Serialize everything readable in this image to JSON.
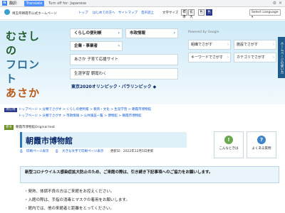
{
  "translate_bar": {
    "logo": "G",
    "label": "翻訳:",
    "translate_button": "Translate",
    "options_link": "Turn off for: Japanese"
  },
  "header": {
    "site_name": "埼玉県朝霞市公式ホームページ",
    "links": [
      "トップ",
      "はじめての方へ",
      "サイトマップ",
      "音声読上"
    ],
    "font_size_label": "文字サイズ",
    "font_buttons": [
      "標準",
      "拡大",
      "色",
      "色"
    ],
    "language_select": "Select Language"
  },
  "hero": {
    "logo_lines": [
      "むさしの",
      "フロント",
      "あさか"
    ],
    "menu": {
      "living": "くらしの便利帳",
      "city": "市政情報",
      "business": "企業・事業者",
      "kids": "あさか 子育て応援サイト",
      "shogai": "生涯学習 朝霞わく"
    },
    "olympics_link": "東京2020オリンピック・パラリンピック ◆",
    "search": {
      "header": "Powered by Google",
      "by_life": "組織でさがす",
      "by_shisetsu": "施設でさがす",
      "by_keyword": "キーワードでさがす",
      "by_other": "カテゴリでさがす"
    },
    "side_tab": "ホームページの使い方"
  },
  "breadcrumbs": {
    "label": "現在地",
    "line1": "トップページ > 分類でさがす > くらしの便利帳 > 教育・文化 > 生涯学習 > 朝霞市博物館",
    "line2": "トップページ > 分類でさがす > 市政情報 > 公共施設一覧 > 博物館 > 朝霞市博物館"
  },
  "gt_notice": {
    "tag": "原文",
    "text": "朝霞市博物館Original text"
  },
  "page": {
    "title": "朝霞市博物館",
    "print_link": "印刷ページ表示",
    "large_print_link": "大きな文字で印刷ページ表示",
    "updated": "更新日：2022年12月5日更新"
  },
  "aside": {
    "trouble_label": "こんなときは",
    "faq_label": "よくある質問"
  },
  "notice": {
    "text": "新型コロナウイルス感染症拡大防止のため、ご来館の際は、引き続き下記事項へのご協力をお願いします。"
  },
  "list": [
    "・発熱、体調不良の方はご来館をお控えください。",
    "・入館の際は、手指の消毒とマスクの着用をお願いします。",
    "・館内では、他の来館者と距離をとってください。"
  ]
}
